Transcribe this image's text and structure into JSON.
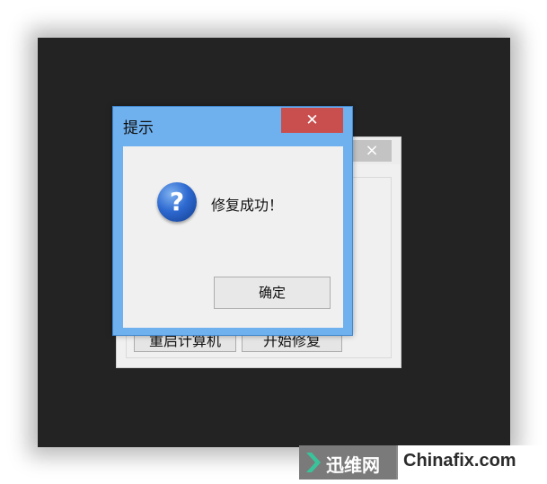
{
  "background_window": {
    "close_glyph": "×",
    "buttons": [
      "重启计算机",
      "开始修复"
    ]
  },
  "dialog": {
    "title": "提示",
    "close_glyph": "✕",
    "icon": "question-icon",
    "icon_glyph": "?",
    "message": "修复成功！",
    "ok_label": "确定"
  },
  "watermark": {
    "cn": "迅维网",
    "en": "Chinafix.com"
  },
  "colors": {
    "dialog_frame": "#6fb0ee",
    "close_button": "#c94e4e",
    "desktop": "#232323"
  }
}
